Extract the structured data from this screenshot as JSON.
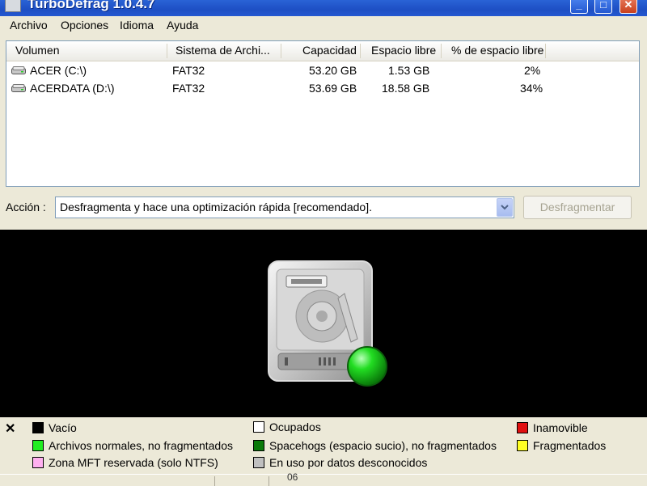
{
  "window": {
    "title": "TurboDefrag 1.0.4.7",
    "min_label": "_",
    "max_label": "□",
    "close_label": "✕"
  },
  "menu": [
    "Archivo",
    "Opciones",
    "Idioma",
    "Ayuda"
  ],
  "table": {
    "headers": [
      "Volumen",
      "Sistema de Archi...",
      "Capacidad",
      "Espacio libre",
      "% de espacio libre"
    ],
    "rows": [
      [
        "ACER (C:\\)",
        "FAT32",
        "53.20 GB",
        "1.53 GB",
        "2%"
      ],
      [
        "ACERDATA (D:\\)",
        "FAT32",
        "53.69 GB",
        "18.58 GB",
        "34%"
      ]
    ]
  },
  "action": {
    "label": "Acción :",
    "value": "Desfragmenta y hace una optimización rápida [recomendado].",
    "button": "Desfragmentar"
  },
  "legend": {
    "close": "✕",
    "items": [
      {
        "label": "Vacío",
        "color": "#000000"
      },
      {
        "label": "Ocupados",
        "color": "#ffffff"
      },
      {
        "label": "Inamovible",
        "color": "#e01010"
      },
      {
        "label": "Archivos normales, no fragmentados",
        "color": "#22ee22"
      },
      {
        "label": "Spacehogs (espacio sucio), no fragmentados",
        "color": "#0a7a0a"
      },
      {
        "label": "Fragmentados",
        "color": "#ffff22"
      },
      {
        "label": "Zona MFT reservada (solo NTFS)",
        "color": "#ffb0f0"
      },
      {
        "label": "En uso por datos desconocidos",
        "color": "#c0c0c0"
      }
    ]
  },
  "status": {
    "text": "06"
  }
}
